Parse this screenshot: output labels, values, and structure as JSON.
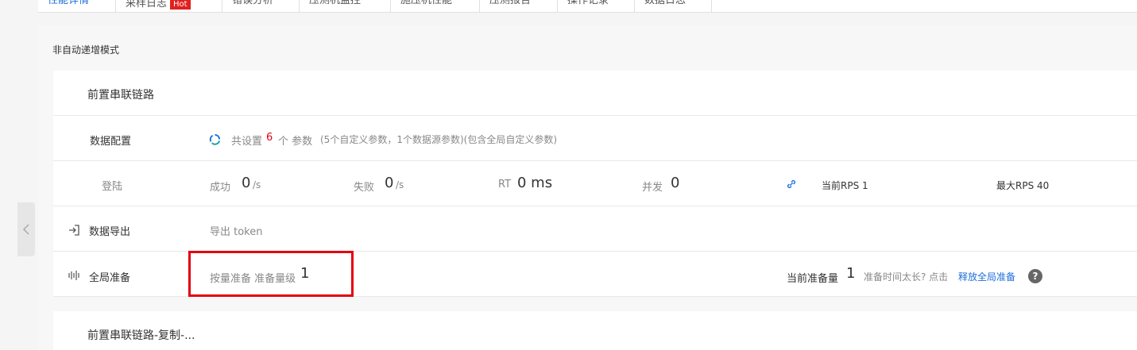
{
  "tabs": [
    {
      "label": "性能详情",
      "active": true
    },
    {
      "label": "采样日志",
      "badge": "Hot"
    },
    {
      "label": "错误分析"
    },
    {
      "label": "压测机监控"
    },
    {
      "label": "施压机性能"
    },
    {
      "label": "压测报告"
    },
    {
      "label": "操作记录"
    },
    {
      "label": "数据日志"
    }
  ],
  "mode_label": "非自动递增模式",
  "chain": {
    "title": "前置串联链路",
    "data_config": {
      "label": "数据配置",
      "prefix": "共设置",
      "count": "6",
      "suffix": "个 参数",
      "detail": "(5个自定义参数，1个数据源参数)(包含全局自定义参数)"
    },
    "login": {
      "label": "登陆",
      "success_label": "成功",
      "success_value": "0",
      "success_unit": "/s",
      "fail_label": "失败",
      "fail_value": "0",
      "fail_unit": "/s",
      "rt_label": "RT",
      "rt_value": "0 ms",
      "concurrency_label": "并发",
      "concurrency_value": "0",
      "current_rps": "当前RPS 1",
      "max_rps": "最大RPS 40"
    },
    "export": {
      "label": "数据导出",
      "text": "导出  token"
    },
    "global_prep": {
      "label": "全局准备",
      "mode": "按量准备 准备量级",
      "level": "1",
      "current_label": "当前准备量",
      "current_value": "1",
      "hint": "准备时间太长? 点击",
      "release_link": "释放全局准备",
      "help": "?"
    }
  },
  "chain_copy_title": "前置串联链路-复制-...",
  "colors": {
    "accent": "#1e6fd9",
    "highlight_box": "#e3000f",
    "count": "#e3000f"
  }
}
